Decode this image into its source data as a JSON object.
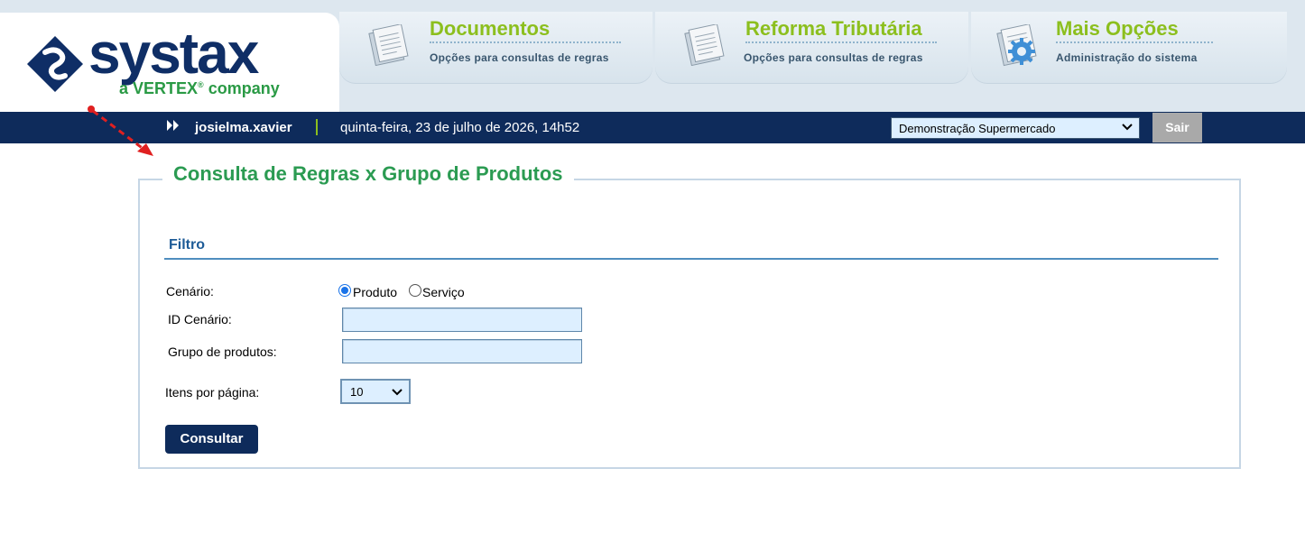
{
  "logo": {
    "wordmark": "systax",
    "tagline_prefix": "a ",
    "tagline_brand": "VERTEX",
    "tagline_reg": "®",
    "tagline_suffix": " company"
  },
  "nav": [
    {
      "title": "Documentos",
      "subtitle": "Opções para consultas de regras",
      "icon": "document-stack-icon"
    },
    {
      "title": "Reforma Tributária",
      "subtitle": "Opções para consultas de regras",
      "icon": "document-stack-icon"
    },
    {
      "title": "Mais Opções",
      "subtitle": "Administração do sistema",
      "icon": "gear-document-icon"
    }
  ],
  "topbar": {
    "username": "josielma.xavier",
    "datetime": "quinta-feira, 23 de julho de 2026, 14h52",
    "company": "Demonstração Supermercado",
    "logout_label": "Sair"
  },
  "page": {
    "title": "Consulta de Regras x Grupo de Produtos",
    "section": "Filtro",
    "fields": {
      "cenario_label": "Cenário:",
      "produto_label": "Produto",
      "servico_label": "Serviço",
      "cenario_selected": "Produto",
      "id_cenario_label": "ID Cenário:",
      "id_cenario_value": "",
      "grupo_label": "Grupo de produtos:",
      "grupo_value": "",
      "itens_label": "Itens por página:",
      "itens_value": "10"
    },
    "submit_label": "Consultar"
  },
  "colors": {
    "navy": "#0e2b5b",
    "green_title": "#2b9b52",
    "nav_title": "#8cbf1e",
    "annotation": "#e02020"
  }
}
